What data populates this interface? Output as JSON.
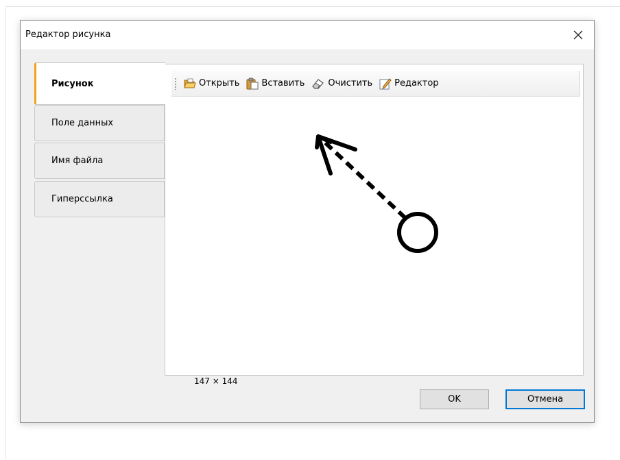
{
  "dialog": {
    "title": "Редактор рисунка",
    "close_icon": "close-icon"
  },
  "tabs": [
    {
      "label": "Рисунок",
      "active": true
    },
    {
      "label": "Поле данных",
      "active": false
    },
    {
      "label": "Имя файла",
      "active": false
    },
    {
      "label": "Гиперссылка",
      "active": false
    }
  ],
  "toolbar": {
    "open_label": "Открыть",
    "paste_label": "Вставить",
    "clear_label": "Очистить",
    "editor_label": "Редактор",
    "icons": [
      "folder-open-icon",
      "clipboard-paste-icon",
      "eraser-icon",
      "edit-pencil-icon"
    ]
  },
  "image": {
    "dimensions": "147 × 144",
    "content": "arrow-with-circle-icon"
  },
  "buttons": {
    "ok_label": "OK",
    "cancel_label": "Отмена"
  },
  "colors": {
    "active_tab_accent": "#f4a11a",
    "default_button_border": "#0078d7"
  }
}
